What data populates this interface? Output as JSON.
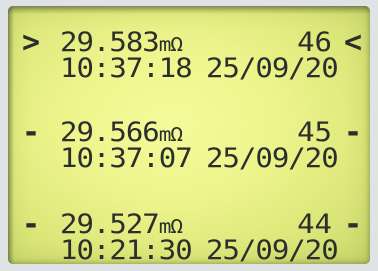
{
  "display": {
    "entries": [
      {
        "left_marker": ">",
        "right_marker": "<",
        "value": "29.583",
        "unit": "mΩ",
        "index": "46",
        "time": "10:37:18",
        "date": "25/09/20"
      },
      {
        "left_marker": "-",
        "right_marker": "-",
        "value": "29.566",
        "unit": "mΩ",
        "index": "45",
        "time": "10:37:07",
        "date": "25/09/20"
      },
      {
        "left_marker": "-",
        "right_marker": "-",
        "value": "29.527",
        "unit": "mΩ",
        "index": "44",
        "time": "10:21:30",
        "date": "25/09/20"
      }
    ]
  },
  "colors": {
    "lcd_background": "#eef58d",
    "lcd_text": "#2a2f2b"
  }
}
